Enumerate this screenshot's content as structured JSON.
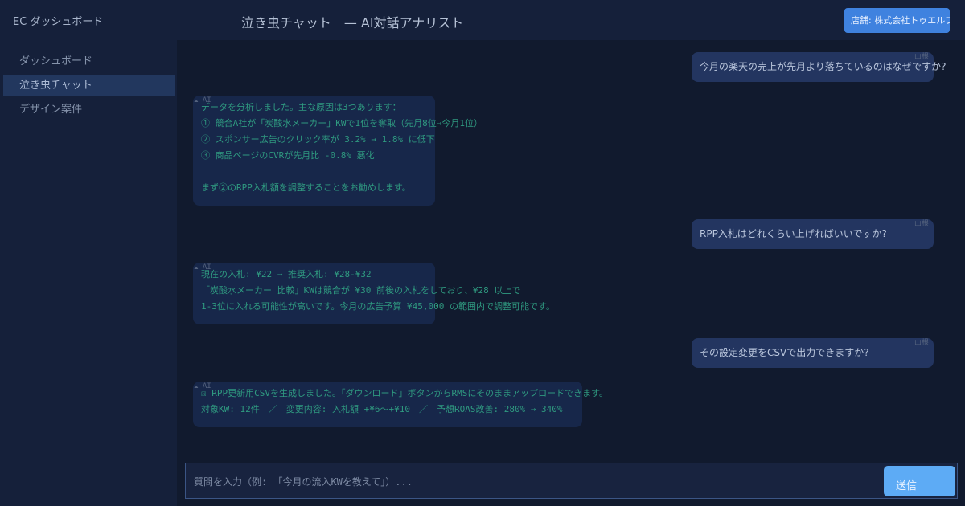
{
  "app": {
    "brand": "EC ダッシュボード"
  },
  "nav": {
    "items": [
      {
        "label": "ダッシュボード",
        "active": false
      },
      {
        "label": "泣き虫チャット",
        "active": true
      },
      {
        "label": "デザイン案件",
        "active": false
      }
    ]
  },
  "header": {
    "title": "泣き虫チャット　— AI対話アナリスト",
    "store_badge": "店舗: 株式会社トゥエルブ"
  },
  "messages": [
    {
      "role": "user",
      "tag": "山根",
      "lines": [
        "今月の楽天の売上が先月より落ちているのはなぜですか?"
      ]
    },
    {
      "role": "ai",
      "tag": "☁ AI",
      "lines": [
        "データを分析しました。主な原因は3つあります：",
        "① 競合A社が「炭酸水メーカー」KWで1位を奪取（先月8位→今月1位）",
        "② スポンサー広告のクリック率が 3.2% → 1.8% に低下",
        "③ 商品ページのCVRが先月比 -0.8% 悪化",
        "",
        "まず②のRPP入札額を調整することをお勧めします。"
      ]
    },
    {
      "role": "user",
      "tag": "山根",
      "lines": [
        "RPP入札はどれくらい上げればいいですか?"
      ]
    },
    {
      "role": "ai",
      "tag": "☁ AI",
      "lines": [
        "現在の入札: ¥22 → 推奨入札: ¥28-¥32",
        "「炭酸水メーカー 比較」KWは競合が ¥30 前後の入札をしており、¥28 以上で",
        "1-3位に入れる可能性が高いです。今月の広告予算 ¥45,000 の範囲内で調整可能です。"
      ]
    },
    {
      "role": "user",
      "tag": "山根",
      "lines": [
        "その設定変更をCSVで出力できますか?"
      ]
    },
    {
      "role": "ai",
      "tag": "☁ AI",
      "lines": [
        "☒ RPP更新用CSVを生成しました。「ダウンロード」ボタンからRMSにそのままアップロードできます。",
        "対象KW: 12件　／　変更内容: 入札額 +¥6〜+¥10　／　予想ROAS改善: 280% → 340%"
      ]
    }
  ],
  "composer": {
    "placeholder": "質問を入力（例: 「今月の流入KWを教えて」）...",
    "send_label": "送信"
  }
}
